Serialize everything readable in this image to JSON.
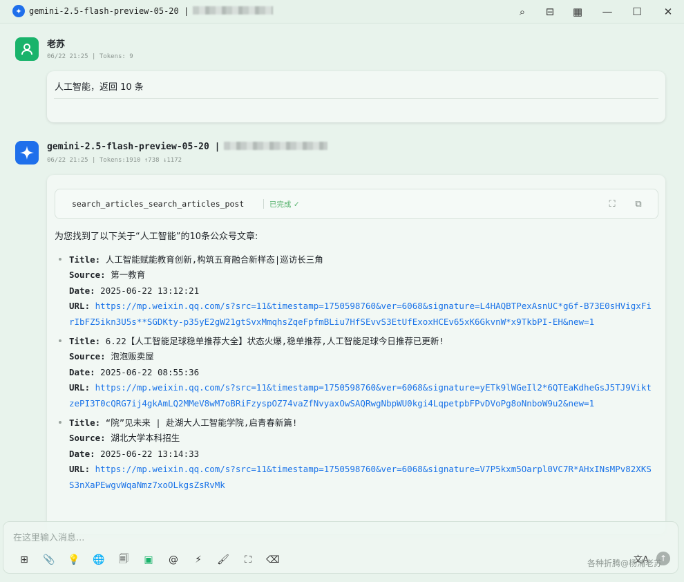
{
  "window": {
    "title": "gemini-2.5-flash-preview-05-20 |",
    "buttons": {
      "search": "⌕",
      "layout": "⊟",
      "grid": "▦",
      "minimize": "—",
      "maximize": "☐",
      "close": "✕"
    }
  },
  "user_message": {
    "name": "老苏",
    "meta": "06/22 21:25 | Tokens: 9",
    "text": "人工智能，返回 10 条"
  },
  "bot_message": {
    "name": "gemini-2.5-flash-preview-05-20 |",
    "meta": "06/22 21:25 | Tokens:1910 ↑738 ↓1172",
    "tool_call": {
      "name": "search_articles_search_articles_post",
      "status": "已完成 ✓"
    },
    "intro": "为您找到了以下关于“人工智能”的10条公众号文章:",
    "labels": {
      "title": "Title:",
      "source": "Source:",
      "date": "Date:",
      "url": "URL:"
    },
    "articles": [
      {
        "title": "人工智能赋能教育创新,构筑五育融合新样态|巡访长三角",
        "source": "第一教育",
        "date": "2025-06-22 13:12:21",
        "url": "https://mp.weixin.qq.com/s?src=11&timestamp=1750598760&ver=6068&signature=L4HAQBTPexAsnUC*g6f-B73E0sHVigxFirIbFZ5ikn3U5s**SGDKty-p35yE2gW21gtSvxMmqhsZqeFpfmBLiu7HfSEvvS3EtUfExoxHCEv65xK6GkvnW*x9TkbPI-EH&new=1"
      },
      {
        "title": "6.22【人工智能足球稳单推荐大全】状态火爆,稳单推荐,人工智能足球今日推荐已更新!",
        "source": "泡泡贩卖屋",
        "date": "2025-06-22 08:55:36",
        "url": "https://mp.weixin.qq.com/s?src=11&timestamp=1750598760&ver=6068&signature=yETk9lWGeIl2*6QTEaKdheGsJ5TJ9ViktzePI3T0cQRG7ij4gkAmLQ2MMeV8wM7oBRiFzyspOZ74vaZfNvyaxOwSAQRwgNbpWU0kgi4LqpetpbFPvDVoPg8oNnboW9u2&new=1"
      },
      {
        "title": "“院”见未来 | 赴湖大人工智能学院,启青春新篇!",
        "source": "湖北大学本科招生",
        "date": "2025-06-22 13:14:33",
        "url": "https://mp.weixin.qq.com/s?src=11&timestamp=1750598760&ver=6068&signature=V7P5kxm5Oarpl0VC7R*AHxINsMPv82XKSS3nXaPEwgvWqaNmz7xoOLkgsZsRvMk"
      }
    ]
  },
  "input": {
    "placeholder": "在这里输入消息...",
    "tools": [
      "⊞",
      "📎",
      "💡",
      "🌐",
      "🗐",
      "▣",
      "@",
      "⚡",
      "🖌",
      "⛶",
      "⌫"
    ],
    "translate": "文A",
    "send": "↑"
  },
  "watermark": "各种折腾@杨浦老苏",
  "colors": {
    "accent": "#1f6feb",
    "user_avatar": "#19b36b",
    "link": "#1a73e8",
    "success": "#52b06a"
  }
}
